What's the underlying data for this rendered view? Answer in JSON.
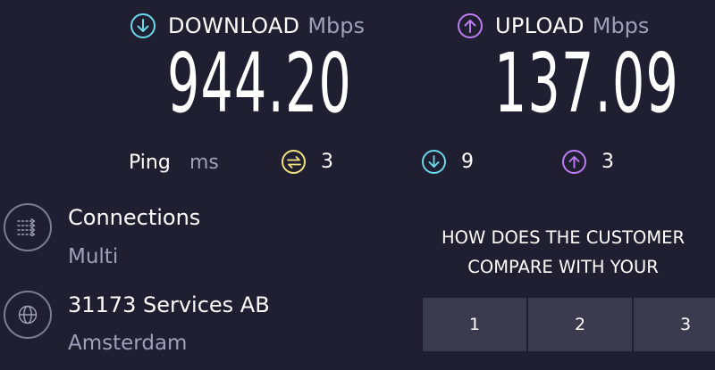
{
  "download": {
    "label": "DOWNLOAD",
    "unit": "Mbps",
    "value": "944.20",
    "icon": "download-arrow-icon",
    "color": "#6ad8e8"
  },
  "upload": {
    "label": "UPLOAD",
    "unit": "Mbps",
    "value": "137.09",
    "icon": "upload-arrow-icon",
    "color": "#bc7cf0"
  },
  "ping": {
    "label": "Ping",
    "unit": "ms",
    "idle": {
      "value": "3",
      "icon": "idle-latency-icon",
      "color": "#f1e27d"
    },
    "download": {
      "value": "9",
      "icon": "download-latency-icon",
      "color": "#6ad8e8"
    },
    "upload": {
      "value": "3",
      "icon": "upload-latency-icon",
      "color": "#bc7cf0"
    }
  },
  "connections": {
    "title": "Connections",
    "value": "Multi",
    "icon": "connections-icon"
  },
  "server": {
    "title": "31173 Services AB",
    "location": "Amsterdam",
    "icon": "globe-icon"
  },
  "survey": {
    "question_line1": "HOW DOES THE CUSTOMER",
    "question_line2": "COMPARE WITH YOUR",
    "options": [
      "1",
      "2",
      "3"
    ]
  }
}
